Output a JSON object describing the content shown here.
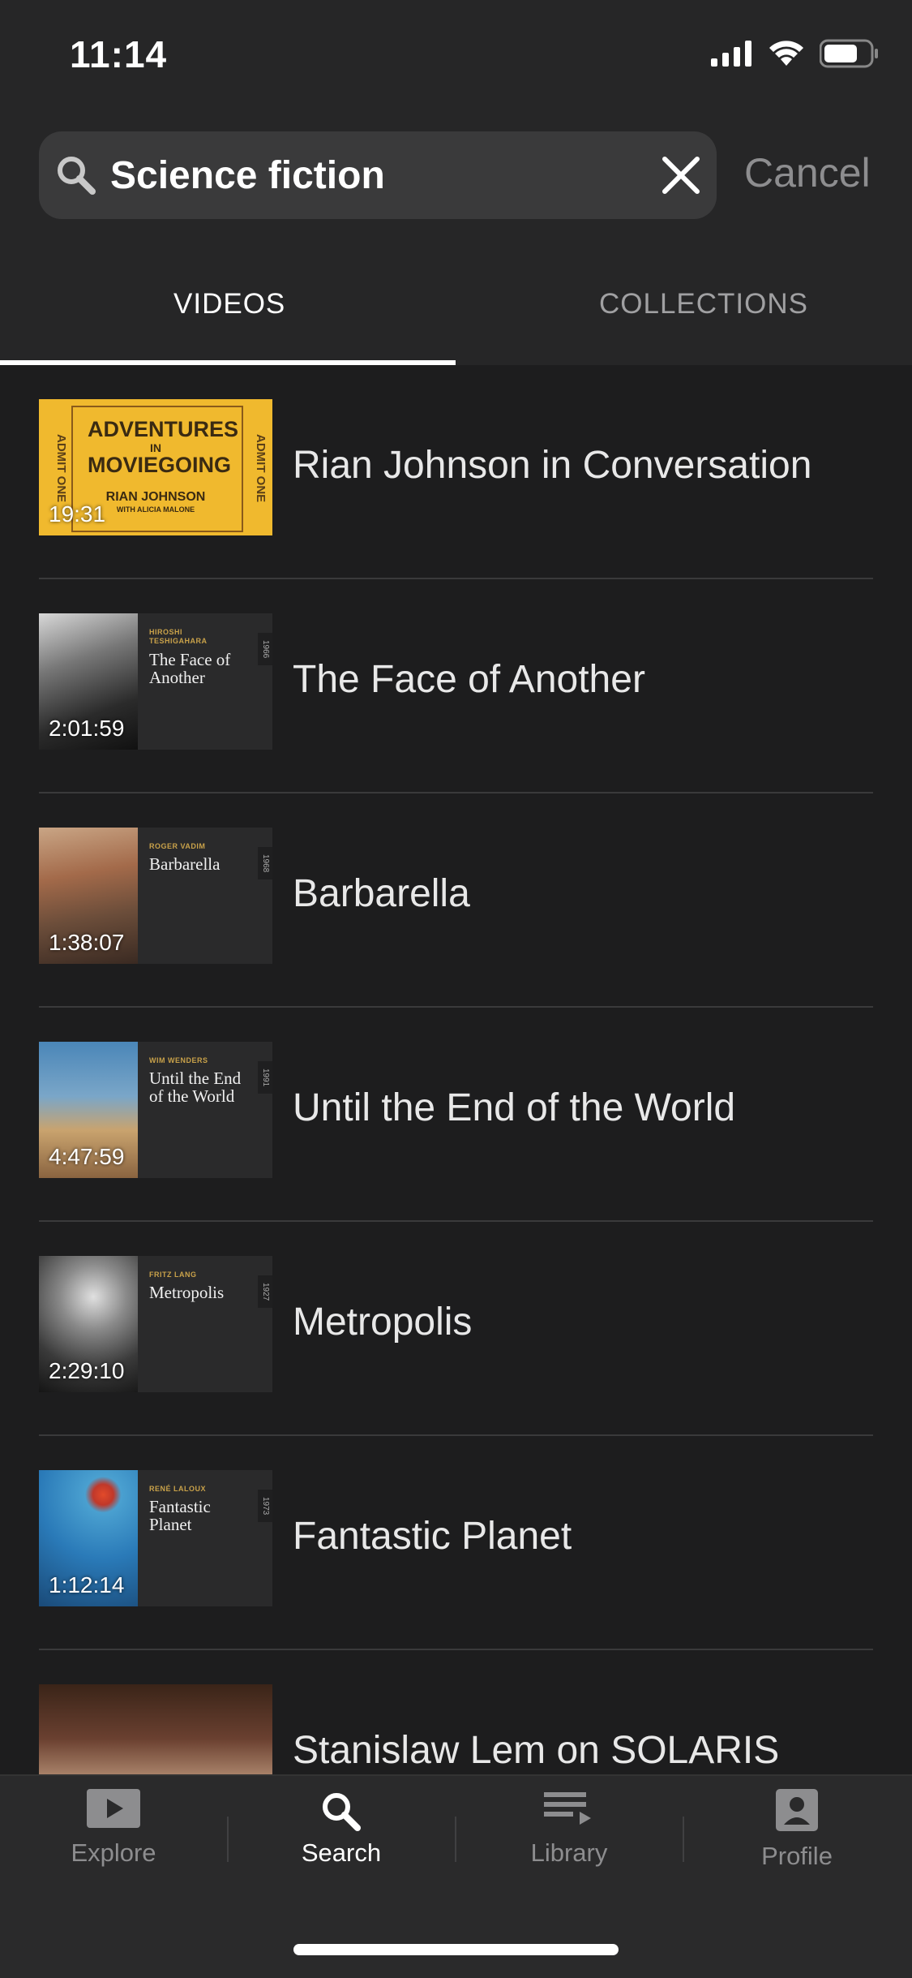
{
  "status": {
    "time": "11:14"
  },
  "search": {
    "query": "Science fiction",
    "cancel_label": "Cancel"
  },
  "tabs": [
    {
      "label": "VIDEOS",
      "active": true
    },
    {
      "label": "COLLECTIONS",
      "active": false
    }
  ],
  "results": [
    {
      "title": "Rian Johnson in Conversation",
      "duration": "19:31",
      "poster": {
        "line1": "ADVENTURES",
        "line2": "IN",
        "line3": "MOVIEGOING",
        "line4": "RIAN JOHNSON",
        "line5": "WITH ALICIA MALONE",
        "admit": "ADMIT ONE"
      }
    },
    {
      "title": "The Face of Another",
      "duration": "2:01:59",
      "director": "HIROSHI TESHIGAHARA",
      "card_title": "The Face of Another",
      "year": "1966"
    },
    {
      "title": "Barbarella",
      "duration": "1:38:07",
      "director": "ROGER VADIM",
      "card_title": "Barbarella",
      "year": "1968"
    },
    {
      "title": "Until the End of the World",
      "duration": "4:47:59",
      "director": "WIM WENDERS",
      "card_title": "Until the End of the World",
      "year": "1991"
    },
    {
      "title": "Metropolis",
      "duration": "2:29:10",
      "director": "FRITZ LANG",
      "card_title": "Metropolis",
      "year": "1927"
    },
    {
      "title": "Fantastic Planet",
      "duration": "1:12:14",
      "director": "RENÉ LALOUX",
      "card_title": "Fantastic Planet",
      "year": "1973"
    },
    {
      "title": "Stanislaw Lem on SOLARIS"
    }
  ],
  "tabbar": [
    {
      "label": "Explore",
      "icon": "play-icon",
      "active": false
    },
    {
      "label": "Search",
      "icon": "search-icon",
      "active": true
    },
    {
      "label": "Library",
      "icon": "library-icon",
      "active": false
    },
    {
      "label": "Profile",
      "icon": "profile-icon",
      "active": false
    }
  ],
  "colors": {
    "background": "#1d1d1e",
    "header": "#262627",
    "accent_gold": "#c9a24a",
    "poster_yellow": "#f0b92e"
  }
}
